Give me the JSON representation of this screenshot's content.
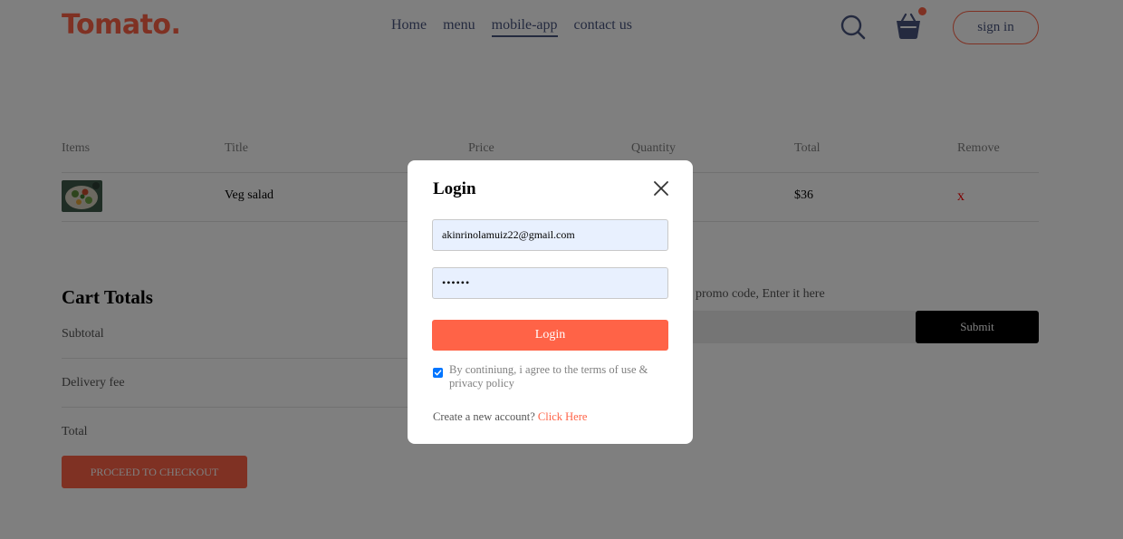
{
  "header": {
    "logo": "Tomato.",
    "nav": [
      "Home",
      "menu",
      "mobile-app",
      "contact us"
    ],
    "active_nav": "mobile-app",
    "signin_label": "sign in"
  },
  "cart": {
    "headers": [
      "Items",
      "Title",
      "Price",
      "Quantity",
      "Total",
      "Remove"
    ],
    "rows": [
      {
        "title": "Veg salad",
        "total": "$36",
        "remove": "x"
      }
    ]
  },
  "totals": {
    "title": "Cart Totals",
    "subtotal_label": "Subtotal",
    "delivery_label": "Delivery fee",
    "total_label": "Total",
    "checkout_label": "PROCEED TO CHECKOUT"
  },
  "promo": {
    "text": "promo code, Enter it here",
    "submit_label": "Submit"
  },
  "login": {
    "title": "Login",
    "email_value": "akinrinolamuiz22@gmail.com",
    "password_value": "••••••",
    "button_label": "Login",
    "agree_text": "By continiung, i agree to the terms of use & privacy policy",
    "create_prompt": "Create a new account?",
    "create_link": "Click Here"
  },
  "colors": {
    "accent": "#ff6347",
    "nav_text": "#49557e",
    "input_fill": "#e8f0fe",
    "checkbox": "#0075ff"
  },
  "icons": [
    "search-icon",
    "basket-icon",
    "close-icon",
    "check-icon"
  ]
}
